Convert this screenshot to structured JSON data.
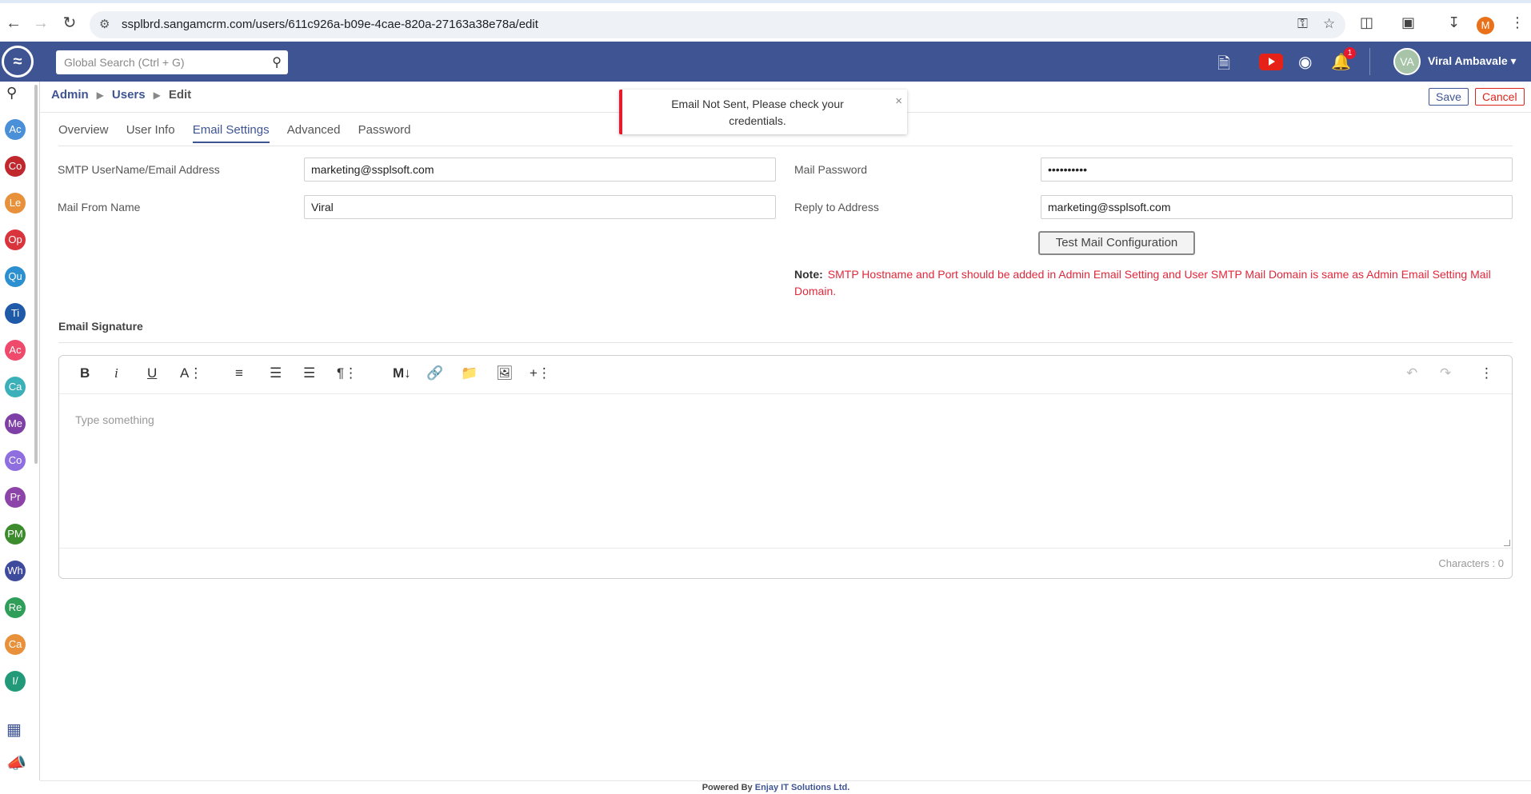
{
  "browser": {
    "url": "ssplbrd.sangamcrm.com/users/611c926a-b09e-4cae-820a-27163a38e78a/edit",
    "profile_initial": "M"
  },
  "header": {
    "search_placeholder": "Global Search (Ctrl + G)",
    "notification_count": "1",
    "user_initials": "VA",
    "user_name": "Viral Ambavale"
  },
  "sidebar": {
    "modules": [
      {
        "label": "Ac",
        "color": "#4a90d9"
      },
      {
        "label": "Co",
        "color": "#c0282d"
      },
      {
        "label": "Le",
        "color": "#e8913a"
      },
      {
        "label": "Op",
        "color": "#d9343c"
      },
      {
        "label": "Qu",
        "color": "#2b8fd0"
      },
      {
        "label": "Ti",
        "color": "#1e5aa8"
      },
      {
        "label": "Ac",
        "color": "#ef4a6b"
      },
      {
        "label": "Ca",
        "color": "#3bb0b8"
      },
      {
        "label": "Me",
        "color": "#7e3fa6"
      },
      {
        "label": "Co",
        "color": "#8f6ee0"
      },
      {
        "label": "Pr",
        "color": "#8c44a8"
      },
      {
        "label": "PM",
        "color": "#3c8c2e"
      },
      {
        "label": "Wh",
        "color": "#3e4b9c"
      },
      {
        "label": "Re",
        "color": "#2f9e58"
      },
      {
        "label": "Ca",
        "color": "#e8913a"
      },
      {
        "label": "I/",
        "color": "#229a7a"
      }
    ]
  },
  "breadcrumb": {
    "admin": "Admin",
    "users": "Users",
    "current": "Edit"
  },
  "actions": {
    "save": "Save",
    "cancel": "Cancel"
  },
  "toast": {
    "message": "Email Not Sent, Please check your credentials.",
    "close": "×"
  },
  "tabs": [
    "Overview",
    "User Info",
    "Email Settings",
    "Advanced",
    "Password"
  ],
  "active_tab": "Email Settings",
  "form": {
    "smtp_label": "SMTP UserName/Email Address",
    "smtp_value": "marketing@ssplsoft.com",
    "password_label": "Mail Password",
    "password_value": "••••••••••",
    "from_label": "Mail From Name",
    "from_value": "Viral",
    "reply_label": "Reply to Address",
    "reply_value": "marketing@ssplsoft.com",
    "test_button": "Test Mail Configuration",
    "note_label": "Note:",
    "note_text": "SMTP Hostname and Port should be added in Admin Email Setting and User SMTP Mail Domain is same as Admin Email Setting Mail Domain."
  },
  "signature": {
    "title": "Email Signature",
    "placeholder": "Type something",
    "char_count": "Characters : 0"
  },
  "footer": {
    "powered_by": "Powered By",
    "company": "Enjay IT Solutions Ltd."
  }
}
